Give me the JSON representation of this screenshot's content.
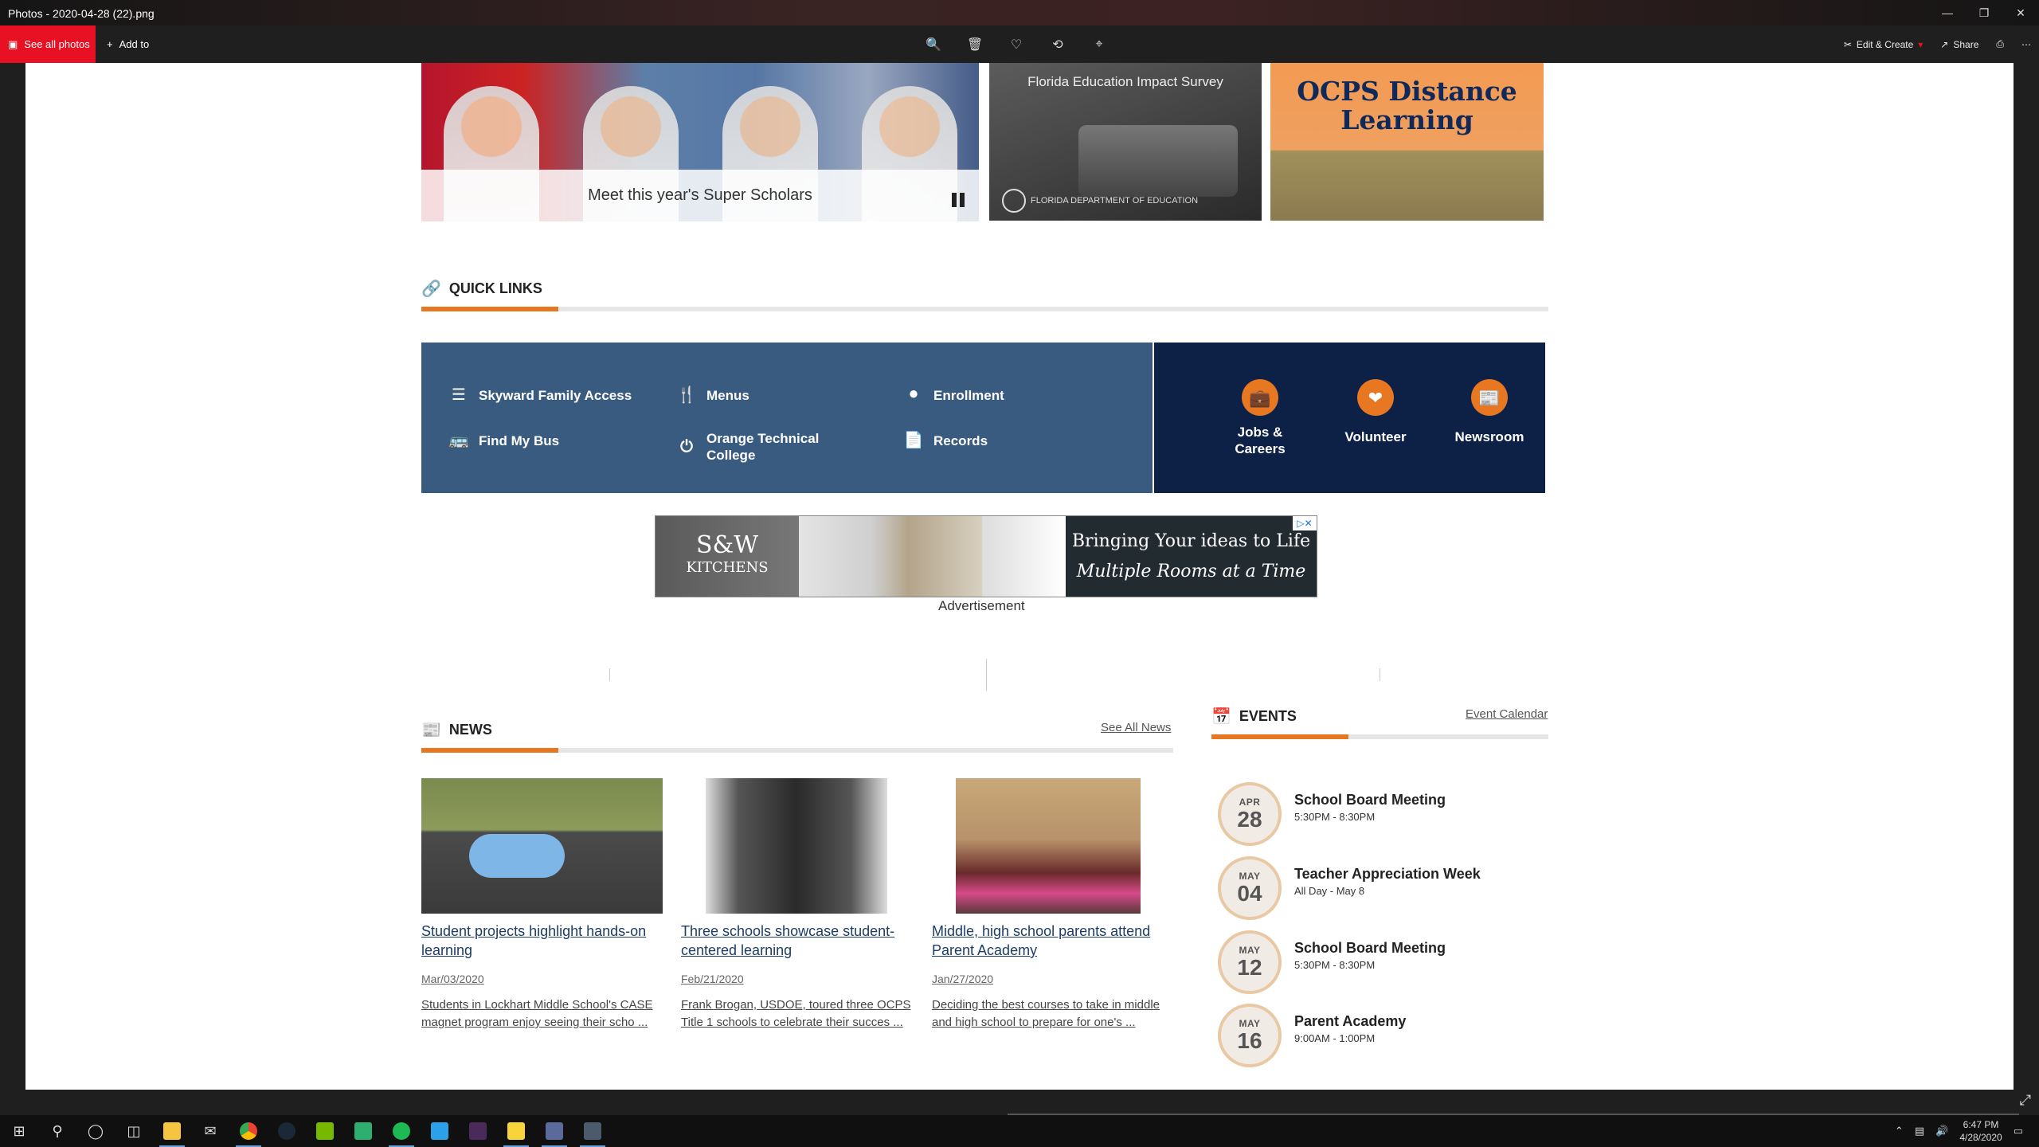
{
  "window": {
    "title": "Photos - 2020-04-28 (22).png",
    "controls": [
      "minimize",
      "restore",
      "close"
    ]
  },
  "toolbar": {
    "see_all": "See all photos",
    "add_to": "Add to",
    "edit_create": "Edit & Create",
    "share": "Share"
  },
  "hero": {
    "caption": "Meet this year's Super Scholars",
    "survey_title": "Florida Education Impact Survey",
    "survey_org": "FLORIDA DEPARTMENT OF EDUCATION",
    "ocps_line1": "OCPS Distance",
    "ocps_line2": "Learning"
  },
  "quick_links": {
    "heading": "QUICK LINKS",
    "items": [
      {
        "label": "Skyward Family Access",
        "icon": "list-icon"
      },
      {
        "label": "Menus",
        "icon": "fork-knife-icon"
      },
      {
        "label": "Enrollment",
        "icon": "torch-icon"
      },
      {
        "label": "Find My Bus",
        "icon": "bus-icon"
      },
      {
        "label": "Orange Technical College",
        "icon": "power-icon"
      },
      {
        "label": "Records",
        "icon": "document-icon"
      }
    ],
    "featured": [
      {
        "label": "Jobs & Careers",
        "icon": "briefcase-icon"
      },
      {
        "label": "Volunteer",
        "icon": "heart-icon"
      },
      {
        "label": "Newsroom",
        "icon": "newspaper-icon"
      }
    ]
  },
  "ad": {
    "brand_line1": "S&W",
    "brand_line2": "KITCHENS",
    "headline": "Bringing Your ideas to Life",
    "subline": "Multiple Rooms at a Time",
    "label": "Advertisement"
  },
  "news": {
    "heading": "NEWS",
    "see_all": "See All News",
    "articles": [
      {
        "title": "Student projects highlight hands-on learning",
        "date": "Mar/03/2020",
        "desc": "Students in Lockhart Middle School's CASE magnet program enjoy seeing their scho ..."
      },
      {
        "title": "Three schools showcase student-centered learning",
        "date": "Feb/21/2020",
        "desc": "Frank Brogan, USDOE, toured three OCPS Title 1 schools to celebrate their succes ..."
      },
      {
        "title": "Middle, high school parents attend Parent Academy",
        "date": "Jan/27/2020",
        "desc": "Deciding the best courses to take in middle and high school to prepare for one's ..."
      }
    ]
  },
  "events": {
    "heading": "EVENTS",
    "calendar_link": "Event Calendar",
    "items": [
      {
        "month": "APR",
        "day": "28",
        "name": "School Board Meeting",
        "time": "5:30PM - 8:30PM"
      },
      {
        "month": "MAY",
        "day": "04",
        "name": "Teacher Appreciation Week",
        "time": "All Day - May 8"
      },
      {
        "month": "MAY",
        "day": "12",
        "name": "School Board Meeting",
        "time": "5:30PM - 8:30PM"
      },
      {
        "month": "MAY",
        "day": "16",
        "name": "Parent Academy",
        "time": "9:00AM - 1:00PM"
      }
    ]
  },
  "taskbar": {
    "time": "6:47 PM",
    "date": "4/28/2020"
  },
  "colors": {
    "accent_orange": "#e87722",
    "quick_links_blue": "#3a5b80",
    "quick_links_navy": "#0d2147",
    "photos_red": "#e81123"
  }
}
